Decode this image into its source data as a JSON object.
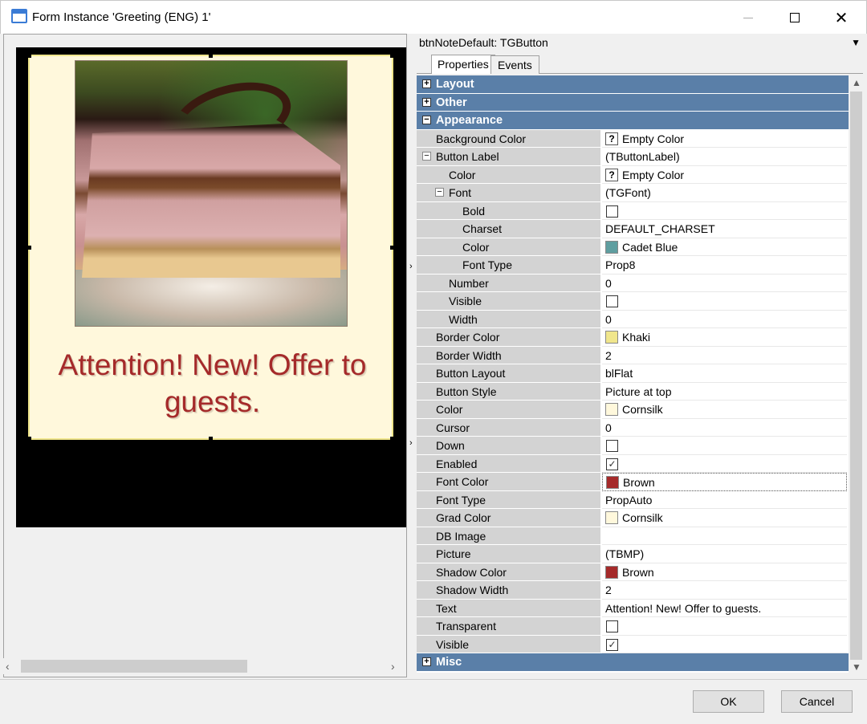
{
  "window": {
    "title": "Form Instance 'Greeting (ENG) 1'"
  },
  "preview": {
    "button_text": "Attention! New! Offer to guests."
  },
  "inspector": {
    "object_selector": "btnNoteDefault: TGButton",
    "tabs": [
      {
        "label": "Properties",
        "active": true
      },
      {
        "label": "Events",
        "active": false
      }
    ],
    "rows": [
      {
        "kind": "cat",
        "label": "Layout",
        "expanded": false
      },
      {
        "kind": "cat",
        "label": "Other",
        "expanded": false
      },
      {
        "kind": "cat",
        "label": "Appearance",
        "expanded": true
      },
      {
        "kind": "prop",
        "indent": 0,
        "name": "Background Color",
        "value": "Empty Color",
        "glyph": "qmark"
      },
      {
        "kind": "prop",
        "indent": 0,
        "name": "Button Label",
        "value": "(TButtonLabel)",
        "expander": "−"
      },
      {
        "kind": "prop",
        "indent": 1,
        "name": "Color",
        "value": "Empty Color",
        "glyph": "qmark"
      },
      {
        "kind": "prop",
        "indent": 1,
        "name": "Font",
        "value": "(TGFont)",
        "expander": "−"
      },
      {
        "kind": "prop",
        "indent": 2,
        "name": "Bold",
        "value": "",
        "glyph": "checkbox",
        "checked": false
      },
      {
        "kind": "prop",
        "indent": 2,
        "name": "Charset",
        "value": "DEFAULT_CHARSET"
      },
      {
        "kind": "prop",
        "indent": 2,
        "name": "Color",
        "value": "Cadet Blue",
        "glyph": "swatch",
        "color": "#5f9ea0"
      },
      {
        "kind": "prop",
        "indent": 2,
        "name": "Font Type",
        "value": "Prop8"
      },
      {
        "kind": "prop",
        "indent": 1,
        "name": "Number",
        "value": "0"
      },
      {
        "kind": "prop",
        "indent": 1,
        "name": "Visible",
        "value": "",
        "glyph": "checkbox",
        "checked": false
      },
      {
        "kind": "prop",
        "indent": 1,
        "name": "Width",
        "value": "0"
      },
      {
        "kind": "prop",
        "indent": 0,
        "name": "Border Color",
        "value": "Khaki",
        "glyph": "swatch",
        "color": "#f0e68c"
      },
      {
        "kind": "prop",
        "indent": 0,
        "name": "Border Width",
        "value": "2"
      },
      {
        "kind": "prop",
        "indent": 0,
        "name": "Button Layout",
        "value": "blFlat"
      },
      {
        "kind": "prop",
        "indent": 0,
        "name": "Button Style",
        "value": "Picture at top"
      },
      {
        "kind": "prop",
        "indent": 0,
        "name": "Color",
        "value": "Cornsilk",
        "glyph": "swatch",
        "color": "#fff8dc"
      },
      {
        "kind": "prop",
        "indent": 0,
        "name": "Cursor",
        "value": "0"
      },
      {
        "kind": "prop",
        "indent": 0,
        "name": "Down",
        "value": "",
        "glyph": "checkbox",
        "checked": false
      },
      {
        "kind": "prop",
        "indent": 0,
        "name": "Enabled",
        "value": "",
        "glyph": "checkbox",
        "checked": true
      },
      {
        "kind": "prop",
        "indent": 0,
        "name": "Font Color",
        "value": "Brown",
        "glyph": "swatch",
        "color": "#a52a2a",
        "selected": true
      },
      {
        "kind": "prop",
        "indent": 0,
        "name": "Font Type",
        "value": "PropAuto"
      },
      {
        "kind": "prop",
        "indent": 0,
        "name": "Grad Color",
        "value": "Cornsilk",
        "glyph": "swatch",
        "color": "#fff8dc"
      },
      {
        "kind": "prop",
        "indent": 0,
        "name": "DB Image",
        "value": ""
      },
      {
        "kind": "prop",
        "indent": 0,
        "name": "Picture",
        "value": "(TBMP)"
      },
      {
        "kind": "prop",
        "indent": 0,
        "name": "Shadow Color",
        "value": "Brown",
        "glyph": "swatch",
        "color": "#a52a2a"
      },
      {
        "kind": "prop",
        "indent": 0,
        "name": "Shadow Width",
        "value": "2"
      },
      {
        "kind": "prop",
        "indent": 0,
        "name": "Text",
        "value": "Attention! New! Offer to guests."
      },
      {
        "kind": "prop",
        "indent": 0,
        "name": "Transparent",
        "value": "",
        "glyph": "checkbox",
        "checked": false
      },
      {
        "kind": "prop",
        "indent": 0,
        "name": "Visible",
        "value": "",
        "glyph": "checkbox",
        "checked": true
      },
      {
        "kind": "cat",
        "label": "Misc",
        "expanded": false
      }
    ]
  },
  "dialog": {
    "ok_label": "OK",
    "cancel_label": "Cancel"
  }
}
